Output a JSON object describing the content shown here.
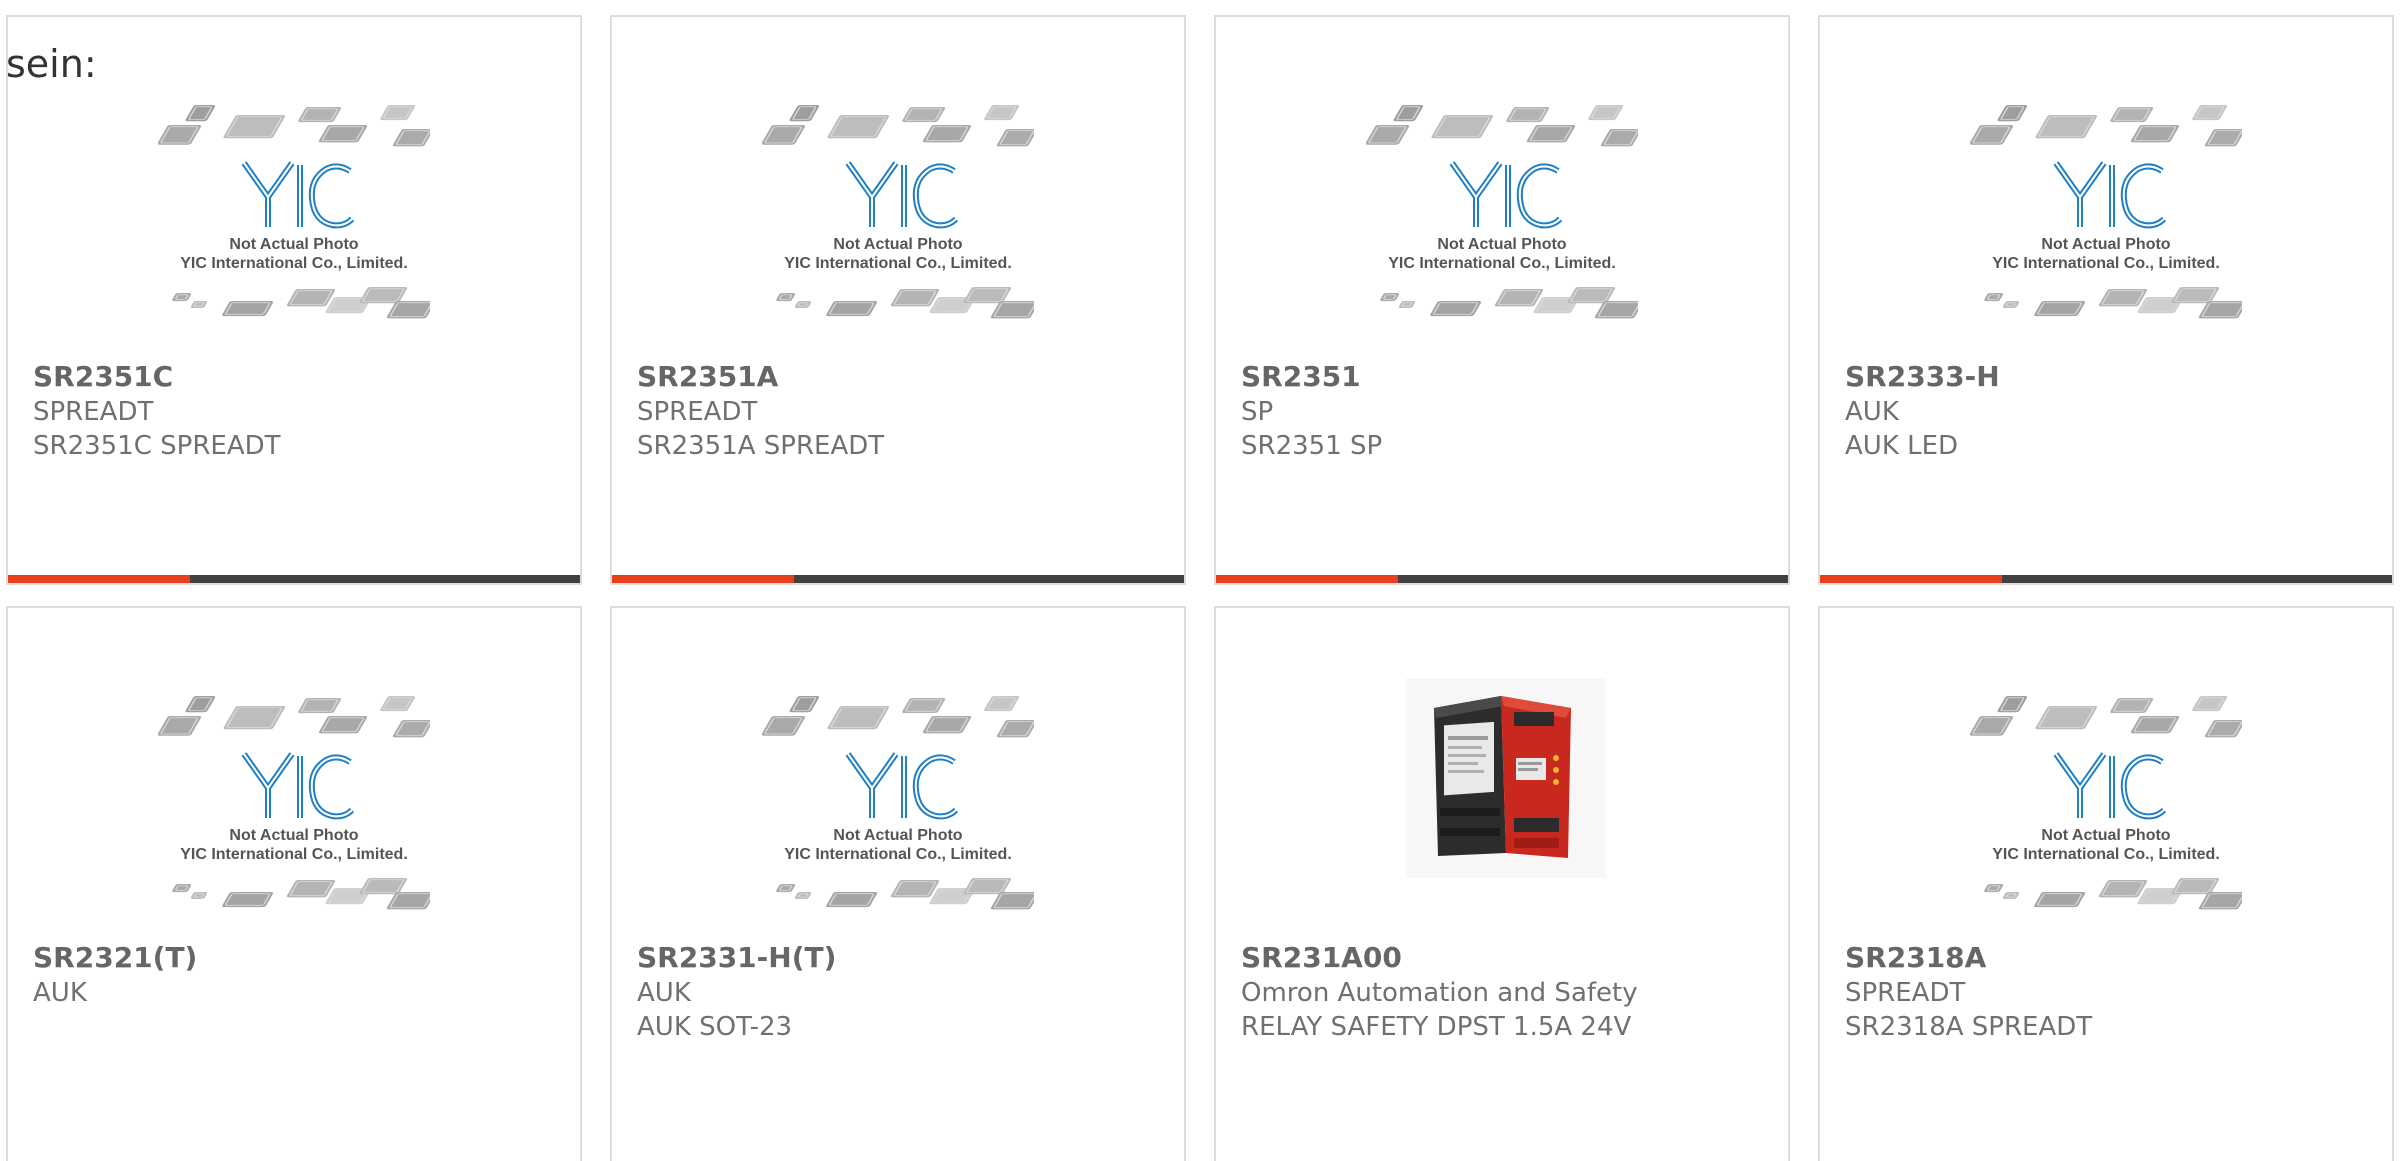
{
  "top_fragment": "sein:",
  "placeholder": {
    "line1": "Not Actual Photo",
    "line2": "YIC International Co., Limited."
  },
  "colors": {
    "accent": "#e8401c",
    "bar": "#404040",
    "logo_blue": "#1f7fc4"
  },
  "products": [
    {
      "part": "SR2351C",
      "maker": "SPREADT",
      "desc": "SR2351C SPREADT",
      "image": "placeholder"
    },
    {
      "part": "SR2351A",
      "maker": "SPREADT",
      "desc": "SR2351A SPREADT",
      "image": "placeholder"
    },
    {
      "part": "SR2351",
      "maker": "SP",
      "desc": "SR2351 SP",
      "image": "placeholder"
    },
    {
      "part": "SR2333-H",
      "maker": "AUK",
      "desc": "AUK LED",
      "image": "placeholder"
    },
    {
      "part": "SR2321(T)",
      "maker": "AUK",
      "desc": "",
      "image": "placeholder"
    },
    {
      "part": "SR2331-H(T)",
      "maker": "AUK",
      "desc": "AUK SOT-23",
      "image": "placeholder"
    },
    {
      "part": "SR231A00",
      "maker": "Omron Automation and Safety",
      "desc": "RELAY SAFETY DPST 1.5A 24V",
      "image": "relay-photo"
    },
    {
      "part": "SR2318A",
      "maker": "SPREADT",
      "desc": "SR2318A SPREADT",
      "image": "placeholder"
    }
  ]
}
